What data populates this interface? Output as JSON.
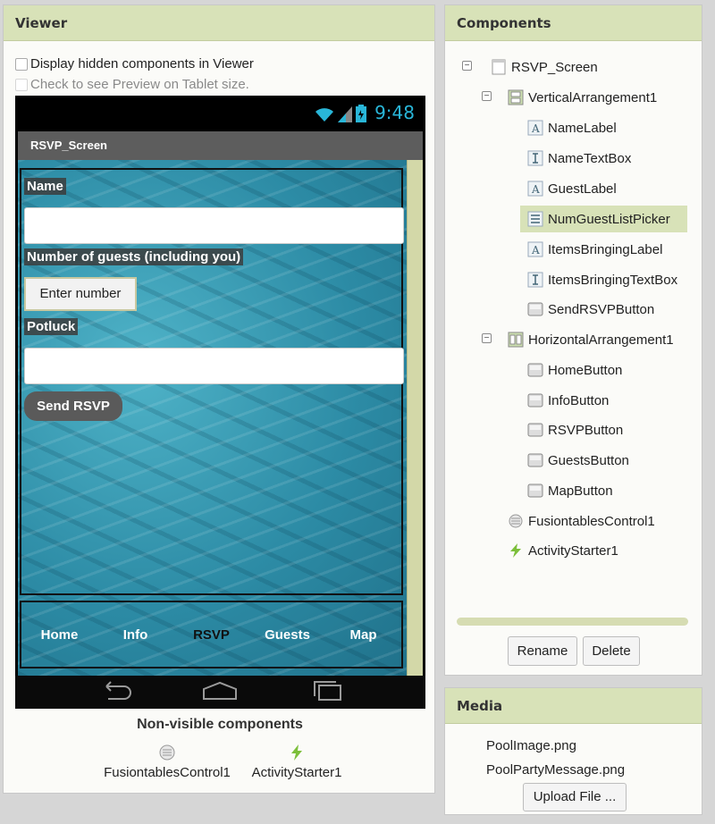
{
  "viewer": {
    "title": "Viewer",
    "display_hidden": "Display hidden components in Viewer",
    "tablet_preview": "Check to see Preview on Tablet size.",
    "status_time": "9:48",
    "screen_title": "RSVP_Screen",
    "app": {
      "name_label": "Name",
      "guests_label": "Number of guests (including you)",
      "picker_text": "Enter number",
      "potluck_label": "Potluck",
      "send_button": "Send RSVP",
      "nav": [
        "Home",
        "Info",
        "RSVP",
        "Guests",
        "Map"
      ]
    },
    "nonvisible_title": "Non-visible components",
    "nonvisible": [
      "FusiontablesControl1",
      "ActivityStarter1"
    ]
  },
  "components": {
    "title": "Components",
    "tree": [
      {
        "label": "RSVP_Screen",
        "icon": "screen-icon"
      },
      {
        "label": "VerticalArrangement1",
        "icon": "vertical-arrangement-icon"
      },
      {
        "label": "NameLabel",
        "icon": "label-icon"
      },
      {
        "label": "NameTextBox",
        "icon": "textbox-icon"
      },
      {
        "label": "GuestLabel",
        "icon": "label-icon"
      },
      {
        "label": "NumGuestListPicker",
        "icon": "listpicker-icon",
        "selected": true
      },
      {
        "label": "ItemsBringingLabel",
        "icon": "label-icon"
      },
      {
        "label": "ItemsBringingTextBox",
        "icon": "textbox-icon"
      },
      {
        "label": "SendRSVPButton",
        "icon": "button-icon"
      },
      {
        "label": "HorizontalArrangement1",
        "icon": "horizontal-arrangement-icon"
      },
      {
        "label": "HomeButton",
        "icon": "button-icon"
      },
      {
        "label": "InfoButton",
        "icon": "button-icon"
      },
      {
        "label": "RSVPButton",
        "icon": "button-icon"
      },
      {
        "label": "GuestsButton",
        "icon": "button-icon"
      },
      {
        "label": "MapButton",
        "icon": "button-icon"
      },
      {
        "label": "FusiontablesControl1",
        "icon": "fusiontables-icon"
      },
      {
        "label": "ActivityStarter1",
        "icon": "activity-starter-icon"
      }
    ],
    "rename": "Rename",
    "delete": "Delete"
  },
  "media": {
    "title": "Media",
    "files": [
      "PoolImage.png",
      "PoolPartyMessage.png"
    ],
    "upload": "Upload File ..."
  },
  "colors": {
    "panel_header": "#d8e2b8",
    "status_accent": "#29b6d8",
    "selected_row": "#d8e2b8"
  }
}
